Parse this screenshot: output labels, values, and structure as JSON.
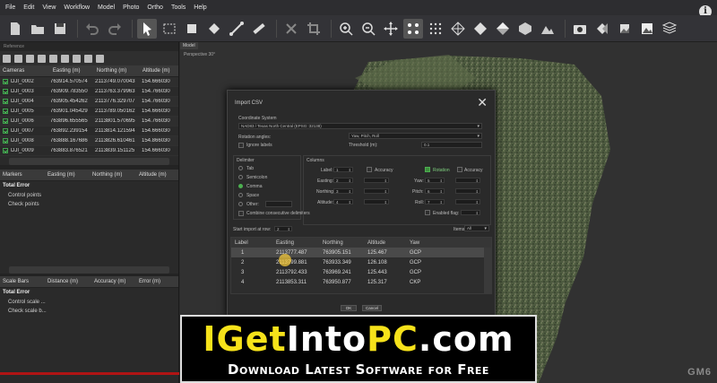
{
  "menu": [
    "File",
    "Edit",
    "View",
    "Workflow",
    "Model",
    "Photo",
    "Ortho",
    "Tools",
    "Help"
  ],
  "left": {
    "panel_title": "Reference",
    "cameras_headers": [
      "Cameras",
      "Easting (m)",
      "Northing (m)",
      "Altitude (m)"
    ],
    "cameras": [
      {
        "label": "DJI_0002",
        "e": "763914.570574",
        "n": "2113749.070043",
        "a": "154.666030"
      },
      {
        "label": "DJI_0003",
        "e": "763909.783550",
        "n": "2113763.379963",
        "a": "154.766030"
      },
      {
        "label": "DJI_0004",
        "e": "763905.454262",
        "n": "2113776.329707",
        "a": "154.766030"
      },
      {
        "label": "DJI_0005",
        "e": "763901.045429",
        "n": "2113789.050162",
        "a": "154.666030"
      },
      {
        "label": "DJI_0006",
        "e": "763896.655565",
        "n": "2113801.570695",
        "a": "154.766030"
      },
      {
        "label": "DJI_0007",
        "e": "763892.239154",
        "n": "2113814.121594",
        "a": "154.666030"
      },
      {
        "label": "DJI_0008",
        "e": "763888.167686",
        "n": "2113826.610461",
        "a": "154.866030"
      },
      {
        "label": "DJI_0009",
        "e": "763883.876521",
        "n": "2113839.151125",
        "a": "154.666030"
      }
    ],
    "markers_headers": [
      "Markers",
      "Easting (m)",
      "Northing (m)",
      "Altitude (m)"
    ],
    "markers_total": "Total Error",
    "markers_items": [
      "Control points",
      "Check points"
    ],
    "scale_headers": [
      "Scale Bars",
      "Distance (m)",
      "Accuracy (m)",
      "Error (m)"
    ],
    "scale_total": "Total Error",
    "scale_items": [
      "Control scale ...",
      "Check scale b..."
    ]
  },
  "viewport": {
    "tab": "Model",
    "label": "Perspective 30°",
    "logo": "GM6"
  },
  "dialog": {
    "title": "Import CSV",
    "crs_label": "Coordinate System",
    "crs_value": "NAD83 / Texas North Central (EPSG::32138)",
    "rot_label": "Rotation angles:",
    "rot_value": "Yaw, Pitch, Roll",
    "ignore_labels": "Ignore labels",
    "threshold_label": "Threshold (m):",
    "threshold_value": "0.1",
    "delimiter_label": "Delimiter",
    "delimiters": [
      "Tab",
      "Semicolon",
      "Comma",
      "Space",
      "Other:"
    ],
    "combine": "Combine consecutive delimiters",
    "columns_label": "Columns",
    "col_left": [
      {
        "label": "Label:",
        "v": "1"
      },
      {
        "label": "Easting:",
        "v": "2"
      },
      {
        "label": "Northing:",
        "v": "3"
      },
      {
        "label": "Altitude:",
        "v": "4"
      }
    ],
    "col_accuracy": "Accuracy",
    "rotation_check": "Rotation",
    "col_right": [
      {
        "label": "Yaw:",
        "v": "5"
      },
      {
        "label": "Pitch:",
        "v": "6"
      },
      {
        "label": "Roll:",
        "v": "7"
      }
    ],
    "enabled_flag": "Enabled flag:",
    "start_import": "Start import at row:",
    "start_value": "2",
    "items_label": "Items:",
    "items_value": "All",
    "table_headers": [
      "Label",
      "Easting",
      "Northing",
      "Altitude",
      "Yaw"
    ],
    "rows": [
      {
        "l": "1",
        "e": "2113777.487",
        "n": "763905.151",
        "a": "125.467",
        "y": "GCP"
      },
      {
        "l": "2",
        "e": "2113799.881",
        "n": "763933.349",
        "a": "126.108",
        "y": "GCP"
      },
      {
        "l": "3",
        "e": "2113792.433",
        "n": "763969.241",
        "a": "125.443",
        "y": "GCP"
      },
      {
        "l": "4",
        "e": "2113853.311",
        "n": "763950.877",
        "a": "125.317",
        "y": "CKP"
      }
    ],
    "ok": "OK",
    "cancel": "Cancel"
  },
  "watermark": {
    "brand_a": "IGet",
    "brand_b": "Into",
    "brand_c": "PC",
    "brand_d": ".com",
    "tagline": "Download Latest Software for Free"
  },
  "colors": {
    "accent_green": "#4caf50",
    "watermark_yellow": "#f6e21a",
    "dark_bg": "#2b2b2b"
  }
}
